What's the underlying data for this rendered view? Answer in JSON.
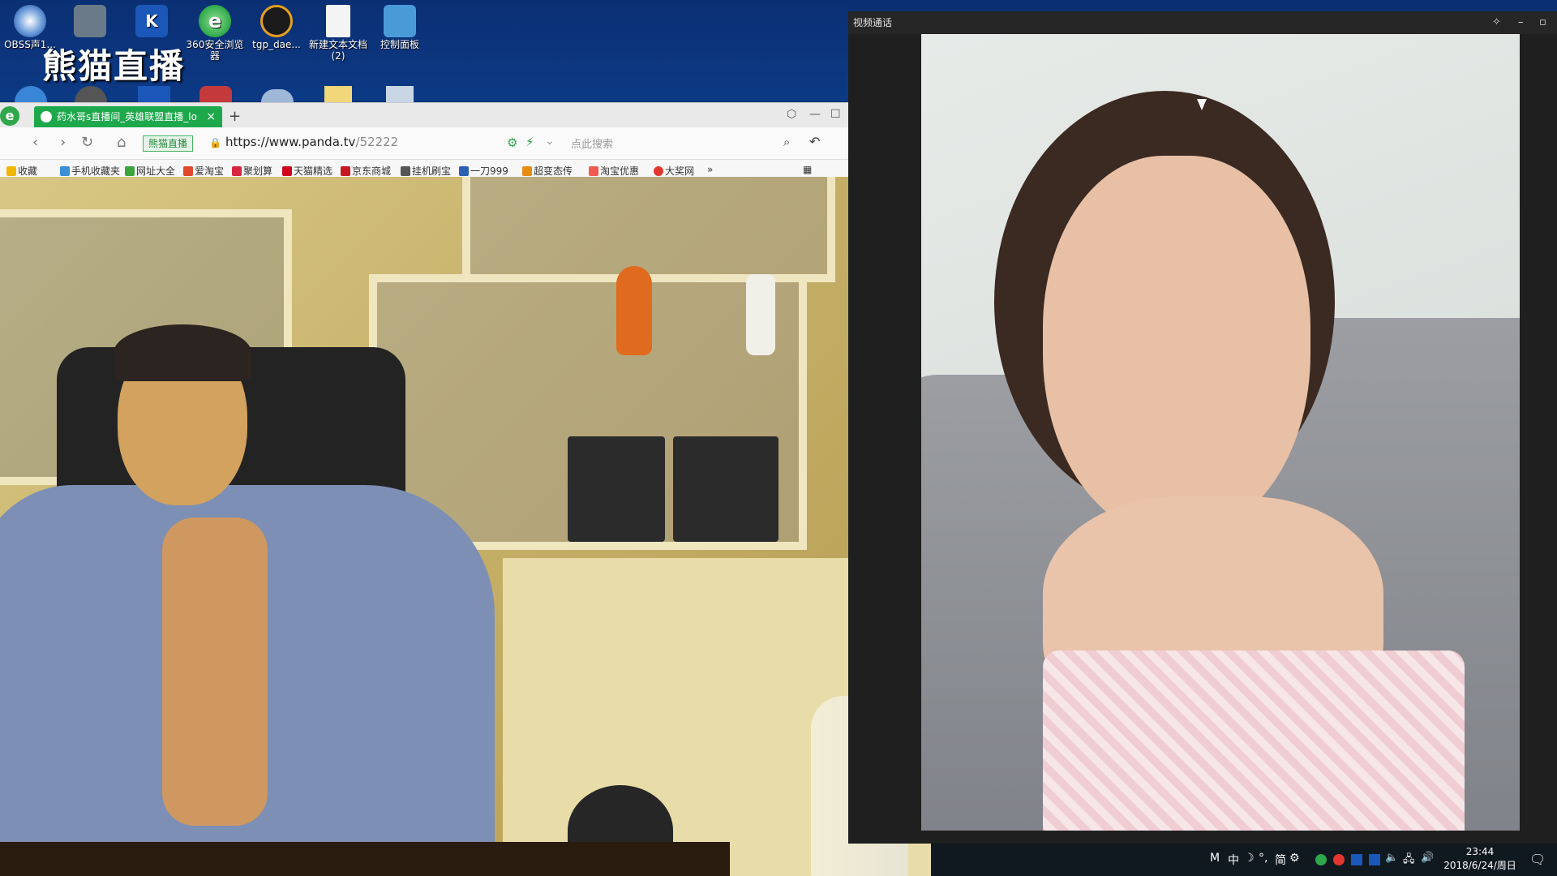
{
  "desktop": {
    "icons": [
      {
        "label": "OBSS声1...",
        "color": "#3d77c7"
      },
      {
        "label": "",
        "color": "#6b7a88"
      },
      {
        "label": "",
        "color": "#1a57b8"
      },
      {
        "label": "360安全浏览器",
        "color": "#2ea84a"
      },
      {
        "label": "tgp_dae...",
        "color": "#e8a01c"
      },
      {
        "label": "新建文本文档 (2)",
        "color": "#f4f4f4"
      },
      {
        "label": "控制面板",
        "color": "#4b9ad8"
      }
    ],
    "watermark": "熊猫直播"
  },
  "browser": {
    "tab_title": "药水哥s直播间_英雄联盟直播_lo",
    "new_tab": "+",
    "site_badge": "熊猫直播",
    "url_host": "https://www.panda.tv",
    "url_path": "/52222",
    "search_placeholder": "点此搜索",
    "favorites": [
      {
        "label": "收藏",
        "color": "#f2b705"
      },
      {
        "label": "手机收藏夹",
        "color": "#3a8fd6"
      },
      {
        "label": "网址大全",
        "color": "#3ba53b"
      },
      {
        "label": "爱淘宝",
        "color": "#e0492e"
      },
      {
        "label": "聚划算",
        "color": "#d7263d"
      },
      {
        "label": "天猫精选",
        "color": "#d0021b"
      },
      {
        "label": "京东商城",
        "color": "#c81623"
      },
      {
        "label": "挂机刷宝",
        "color": "#555555"
      },
      {
        "label": "一刀999",
        "color": "#2d5fb4"
      },
      {
        "label": "超变态传",
        "color": "#e88d14"
      },
      {
        "label": "淘宝优惠",
        "color": "#f05a4f"
      },
      {
        "label": "大奖网",
        "color": "#e2372e"
      }
    ],
    "more": "»"
  },
  "call_window": {
    "title": "视频通话",
    "pin": "📌",
    "minimize": "–",
    "maximize": "▫"
  },
  "taskbar": {
    "tray_items": [
      "M",
      "中",
      "☽",
      "°,",
      "简",
      "⚙"
    ],
    "time": "23:44",
    "date": "2018/6/24/周日"
  }
}
